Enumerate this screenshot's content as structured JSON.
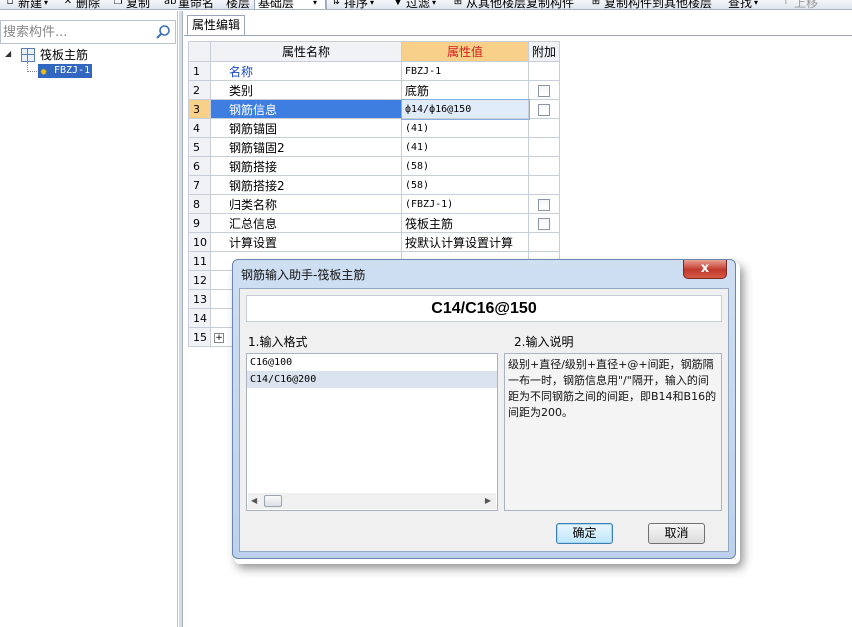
{
  "toolbar": {
    "items": [
      "新建",
      "删除",
      "复制",
      "重命名",
      "楼层",
      "排序",
      "过滤",
      "从其他楼层复制构件",
      "复制构件到其他楼层",
      "查找",
      "上移"
    ],
    "floor_value": "基础层"
  },
  "left_panel": {
    "search_placeholder": "搜索构件...",
    "tree_root": "筏板主筋",
    "tree_child": "FBZJ-1"
  },
  "properties": {
    "tab_label": "属性编辑",
    "headers": {
      "name": "属性名称",
      "value": "属性值",
      "add": "附加"
    },
    "rows": [
      {
        "num": "1",
        "name": "名称",
        "value": "FBZJ-1"
      },
      {
        "num": "2",
        "name": "类别",
        "value": "底筋"
      },
      {
        "num": "3",
        "name": "钢筋信息",
        "value": "ф14/ф16@150"
      },
      {
        "num": "4",
        "name": "钢筋锚固",
        "value": "(41)"
      },
      {
        "num": "5",
        "name": "钢筋锚固2",
        "value": "(41)"
      },
      {
        "num": "6",
        "name": "钢筋搭接",
        "value": "(58)"
      },
      {
        "num": "7",
        "name": "钢筋搭接2",
        "value": "(58)"
      },
      {
        "num": "8",
        "name": "归类名称",
        "value": "(FBZJ-1)"
      },
      {
        "num": "9",
        "name": "汇总信息",
        "value": "筏板主筋"
      },
      {
        "num": "10",
        "name": "计算设置",
        "value": "按默认计算设置计算"
      },
      {
        "num": "11",
        "name": "",
        "value": ""
      },
      {
        "num": "12",
        "name": "",
        "value": ""
      },
      {
        "num": "13",
        "name": "",
        "value": ""
      },
      {
        "num": "14",
        "name": "",
        "value": ""
      },
      {
        "num": "15",
        "name": "",
        "value": ""
      }
    ]
  },
  "dialog": {
    "title": "钢筋输入助手-筏板主筋",
    "close": "x",
    "formula": "C14/C16@150",
    "format_label": "1.输入格式",
    "desc_label": "2.输入说明",
    "formats": [
      "C16@100",
      "C14/C16@200"
    ],
    "description": "级别+直径/级别+直径+@+间距，钢筋隔一布一时，钢筋信息用\"/\"隔开，输入的间距为不同钢筋之间的间距，即B14和B16的间距为200。",
    "ok": "确定",
    "cancel": "取消"
  }
}
